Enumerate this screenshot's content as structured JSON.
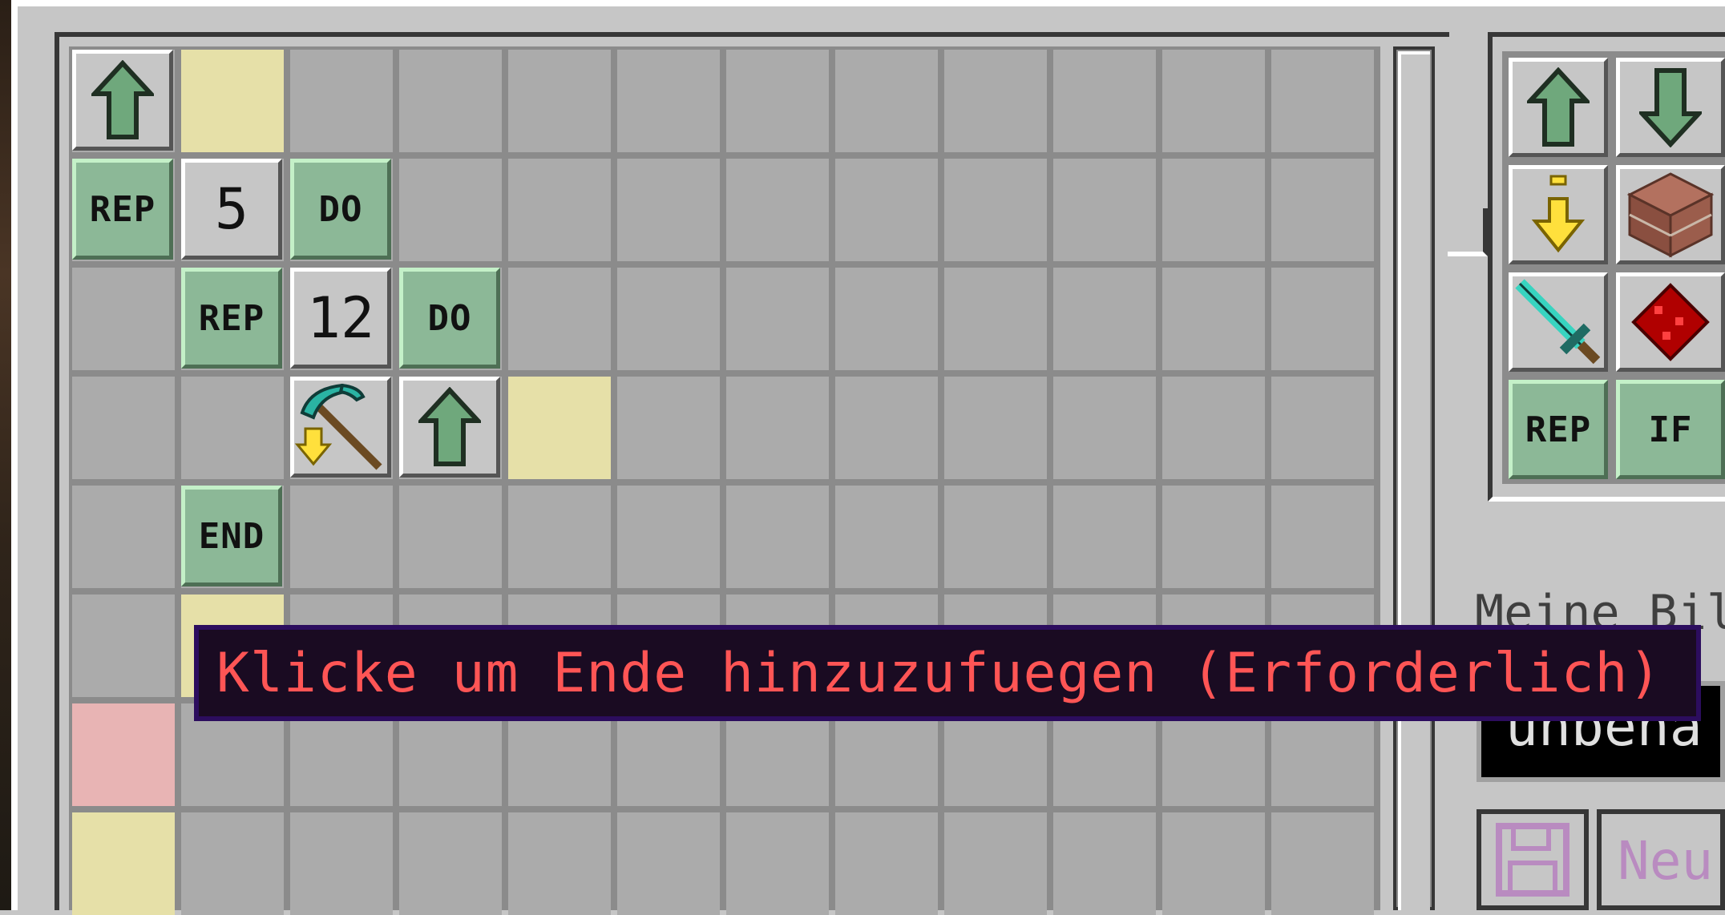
{
  "grid": {
    "row1": {
      "move_up": "move-up"
    },
    "row2": {
      "rep_label": "REP",
      "count": "5",
      "do_label": "DO"
    },
    "row3": {
      "rep_label": "REP",
      "count": "12",
      "do_label": "DO"
    },
    "row4": {
      "mine_down": "pickaxe-down",
      "move_up": "move-up"
    },
    "row5": {
      "end_label": "END"
    }
  },
  "palette": {
    "items": [
      {
        "icon": "arrow-up-icon"
      },
      {
        "icon": "arrow-down-icon"
      },
      {
        "icon": "dig-down-icon"
      },
      {
        "icon": "brick-block-icon"
      },
      {
        "icon": "diamond-sword-icon"
      },
      {
        "icon": "redstone-icon"
      },
      {
        "label": "REP"
      },
      {
        "label": "IF"
      }
    ]
  },
  "side": {
    "programs_label": "Meine Bil",
    "name_value": "unbena",
    "new_button_label": "Neu"
  },
  "tooltip": {
    "text": "Klicke um Ende hinzuzufuegen (Erforderlich)"
  },
  "colors": {
    "tile_green": "#8cb897",
    "slot_yellow": "#e6e0a8",
    "slot_red": "#e8b4b4",
    "tooltip_text": "#ff5555",
    "tooltip_bg": "#1a0b22"
  }
}
